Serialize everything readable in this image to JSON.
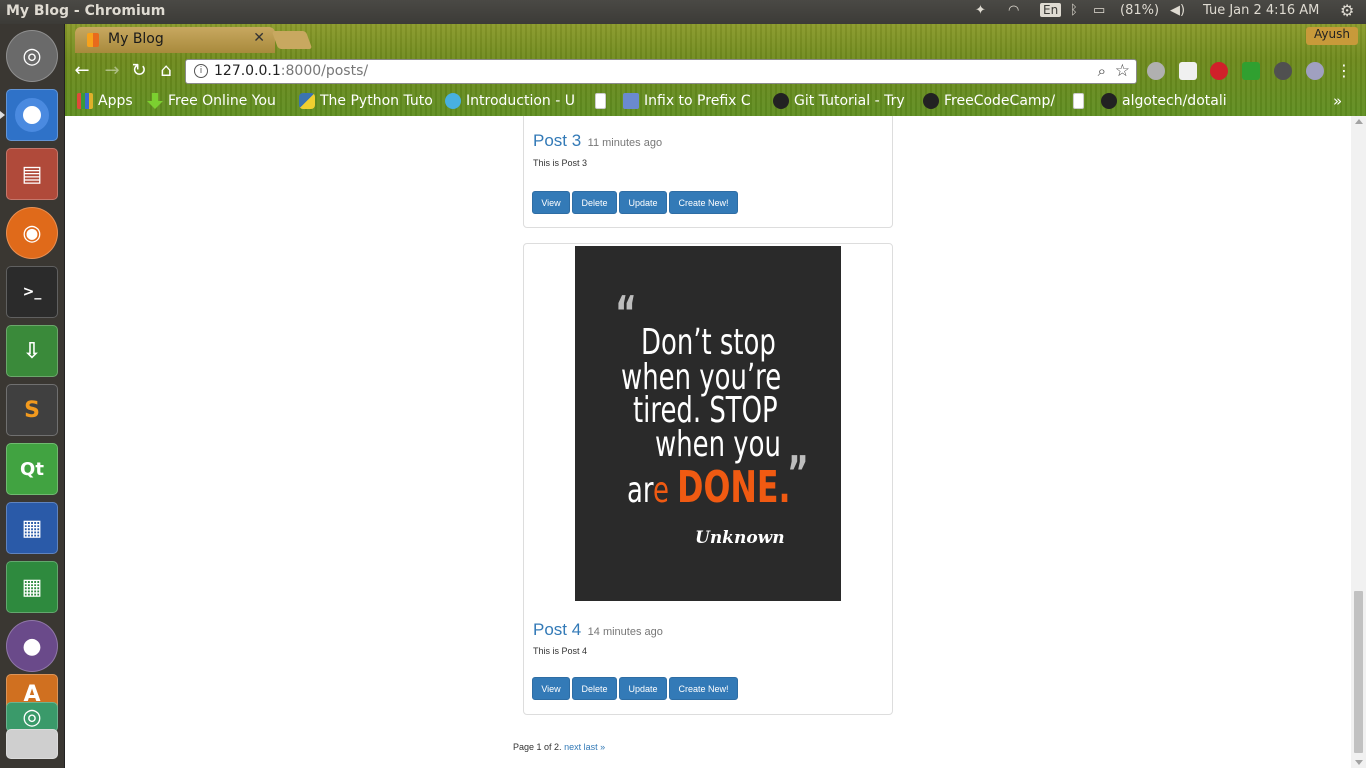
{
  "window": {
    "title": "My Blog - Chromium"
  },
  "system_tray": {
    "keyboard": "En",
    "battery": "(81%)",
    "datetime": "Tue Jan  2  4:16 AM"
  },
  "browser": {
    "tab_title": "My Blog",
    "profile": "Ayush",
    "url_host": "127.0.0.1",
    "url_rest": ":8000/posts/",
    "bookmarks": [
      {
        "label": "Apps",
        "icon": "apps-grid-icon",
        "color": "#e04a3a"
      },
      {
        "label": "Free Online You",
        "icon": "download-arrow-icon",
        "color": "#7cd030"
      },
      {
        "label": "The Python Tuto",
        "icon": "python-icon",
        "color": "#3b74b0"
      },
      {
        "label": "Introduction - U",
        "icon": "bracket-icon",
        "color": "#48b0e0"
      },
      {
        "label": "",
        "icon": "page-icon",
        "color": "#ffffff"
      },
      {
        "label": "Infix to Prefix C",
        "icon": "infix-icon",
        "color": "#6a8ad0"
      },
      {
        "label": "Git Tutorial - Try",
        "icon": "octocat-icon",
        "color": "#222222"
      },
      {
        "label": "FreeCodeCamp/",
        "icon": "github-icon",
        "color": "#222222"
      },
      {
        "label": "",
        "icon": "page-icon",
        "color": "#ffffff"
      },
      {
        "label": "algotech/dotali",
        "icon": "github-icon",
        "color": "#222222"
      }
    ]
  },
  "posts": [
    {
      "title": "Post 3",
      "age": "11 minutes ago",
      "body": "This is Post 3",
      "buttons": [
        "View",
        "Delete",
        "Update",
        "Create New!"
      ]
    },
    {
      "title": "Post 4",
      "age": "14 minutes ago",
      "body": "This is Post 4",
      "buttons": [
        "View",
        "Delete",
        "Update",
        "Create New!"
      ],
      "image_quote": {
        "open_mark": "“",
        "line1": "Don’t stop",
        "line2": "when you’re",
        "line3": "tired. STOP",
        "line4": "when you",
        "line5_a": "ar",
        "line5_b": "e",
        "line5_c": "DONE.",
        "close_mark": "”",
        "author": "Unknown"
      }
    }
  ],
  "pagination": {
    "text": "Page 1 of 2.",
    "next": "next",
    "last": "last »"
  },
  "colors": {
    "link": "#337ab7",
    "button": "#337ab7",
    "quote_accent": "#f05a12",
    "quote_bg": "#2a2a2a"
  }
}
